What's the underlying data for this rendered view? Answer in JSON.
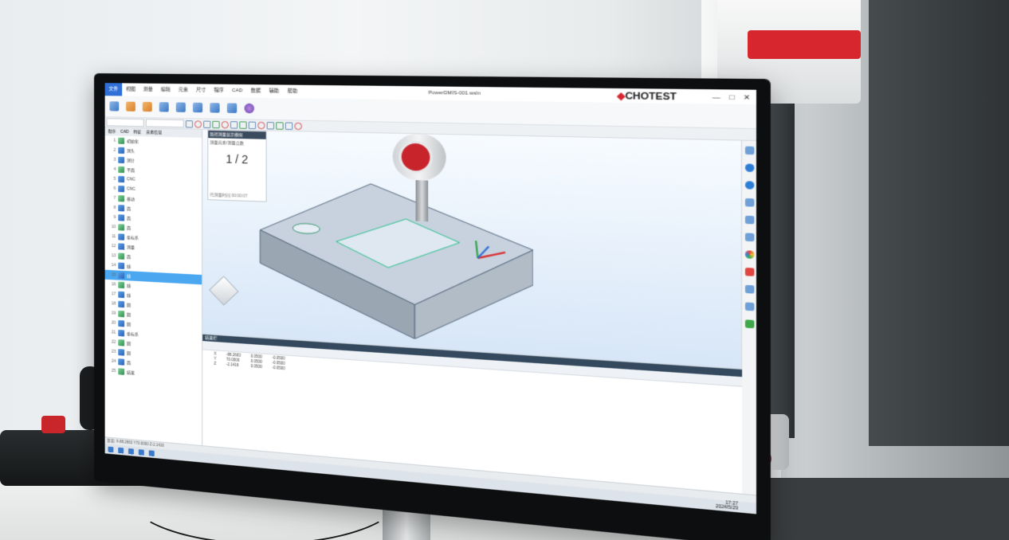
{
  "app": {
    "menu": [
      "文件",
      "视图",
      "测量",
      "编辑",
      "元素",
      "尺寸",
      "程序",
      "CAD",
      "数据",
      "辅助",
      "帮助"
    ],
    "document_title": "PowerDMIS-001.wsln",
    "brand": "CHOTEST",
    "window_buttons": [
      "—",
      "□",
      "✕"
    ]
  },
  "tree": {
    "tabs": [
      "程序",
      "CAD",
      "特征",
      "元素信息"
    ],
    "rows": [
      {
        "num": "1",
        "label": "初始化"
      },
      {
        "num": "2",
        "label": "测头"
      },
      {
        "num": "3",
        "label": "测针"
      },
      {
        "num": "4",
        "label": "平面"
      },
      {
        "num": "5",
        "label": "CNC"
      },
      {
        "num": "6",
        "label": "CNC"
      },
      {
        "num": "7",
        "label": "移动"
      },
      {
        "num": "8",
        "label": "面"
      },
      {
        "num": "9",
        "label": "面"
      },
      {
        "num": "10",
        "label": "面"
      },
      {
        "num": "11",
        "label": "坐标系"
      },
      {
        "num": "12",
        "label": "测量"
      },
      {
        "num": "13",
        "label": "面"
      },
      {
        "num": "14",
        "label": "线"
      },
      {
        "num": "15",
        "label": "线"
      },
      {
        "num": "16",
        "label": "线"
      },
      {
        "num": "17",
        "label": "线"
      },
      {
        "num": "18",
        "label": "圆"
      },
      {
        "num": "19",
        "label": "圆"
      },
      {
        "num": "20",
        "label": "圆"
      },
      {
        "num": "21",
        "label": "坐标系"
      },
      {
        "num": "22",
        "label": "圆"
      },
      {
        "num": "23",
        "label": "圆"
      },
      {
        "num": "24",
        "label": "面"
      },
      {
        "num": "25",
        "label": "结果"
      }
    ],
    "selected_index": 14
  },
  "popup": {
    "head": "路径测量显示模拟",
    "sub": "测量元素/测量点数",
    "count": "1 / 2",
    "foot": "已测量时间 00:00:07"
  },
  "results": {
    "head": "结果栏",
    "table": [
      [
        "X",
        "-88.2663",
        "0.0500",
        "-0.0500"
      ],
      [
        "Y",
        "70.0000",
        "0.0500",
        "-0.0500"
      ],
      [
        "Z",
        "-2.1416",
        "0.0500",
        "-0.0500"
      ]
    ]
  },
  "statusbar": {
    "text": "距离: X-88.2663  Y70.0000  Z-2.1416",
    "readout_a": "A:0.0  B:0.0",
    "readout_b": "1.000  1.000  0.000"
  },
  "tray": {
    "lang": "中",
    "time": "17:27",
    "date": "2024/5/29"
  },
  "colors": {
    "accent": "#2f6fd6",
    "brand_red": "#d7262e",
    "probe_red": "#c8242b",
    "selection": "#4aa7f0"
  }
}
